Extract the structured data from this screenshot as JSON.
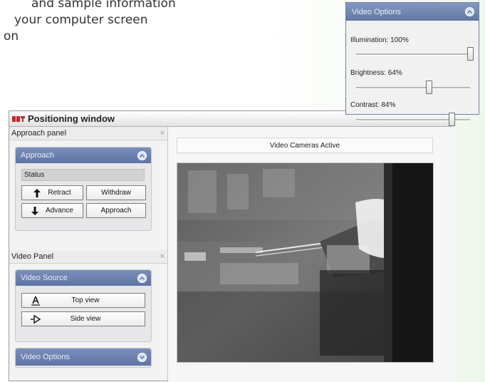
{
  "background_text": {
    "lines": [
      "and sample information",
      "your computer screen",
      "on"
    ]
  },
  "window": {
    "title": "Positioning window"
  },
  "approach_panel": {
    "title": "Approach panel",
    "close_glyph": "×",
    "group_title": "Approach",
    "status_label": "Status",
    "buttons": {
      "retract": "Retract",
      "withdraw": "Withdraw",
      "advance": "Advance",
      "approach": "Approach"
    }
  },
  "video_panel": {
    "title": "Video Panel",
    "close_glyph": "×",
    "source_group_title": "Video Source",
    "top_view": "Top view",
    "side_view": "Side view",
    "options_group_title": "Video Options"
  },
  "video_display": {
    "status": "Video Cameras Active"
  },
  "video_options": {
    "title": "Video Options",
    "illumination_label": "Illumination: 100%",
    "illumination_value": 100,
    "brightness_label": "Brightness: 64%",
    "brightness_value": 64,
    "contrast_label": "Contrast: 84%",
    "contrast_value": 84
  },
  "colors": {
    "group_header": "#5d74a6",
    "logo_red": "#c1282d"
  },
  "icons": {
    "retract": "arrow-up-icon",
    "advance": "arrow-down-icon",
    "top_view": "top-view-icon",
    "side_view": "side-view-icon",
    "collapse": "chevron-up-icon"
  }
}
